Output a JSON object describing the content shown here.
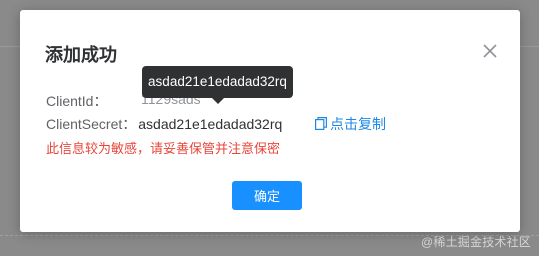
{
  "dialog": {
    "title": "添加成功",
    "client_id_label": "ClientId：",
    "client_id_value": "1129sads",
    "client_secret_label": "ClientSecret：",
    "client_secret_value": "asdad21e1edadad32rq",
    "copy_label": "点击复制",
    "warning_text": "此信息较为敏感，请妥善保管并注意保密",
    "confirm_label": "确定"
  },
  "tooltip": {
    "text": "asdad21e1edadad32rq"
  },
  "watermark": {
    "text": "@稀土掘金技术社区"
  },
  "colors": {
    "overlay": "#8a8a8a",
    "primary": "#1890ff",
    "link": "#1e88e5",
    "warning": "#e8463a",
    "tooltip_bg": "#303133"
  },
  "icons": {
    "close": "close-icon",
    "copy": "copy-icon"
  }
}
